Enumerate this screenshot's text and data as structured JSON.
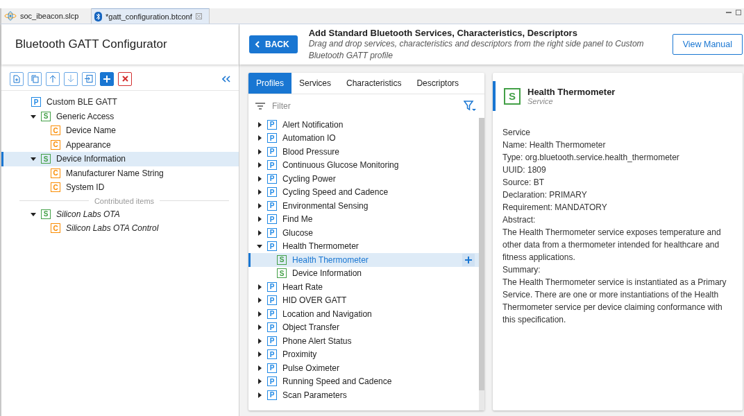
{
  "editor_tabs": [
    {
      "label": "soc_ibeacon.slcp",
      "kind": "project",
      "selected": false,
      "closable": false
    },
    {
      "label": "*gatt_configuration.btconf",
      "kind": "bluetooth",
      "selected": true,
      "closable": true
    }
  ],
  "configurator": {
    "title": "Bluetooth GATT Configurator",
    "tree": [
      {
        "label": "Custom BLE GATT",
        "kind": "profile",
        "badge": "P",
        "selected": false,
        "children": [
          {
            "label": "Generic Access",
            "kind": "service",
            "badge": "S",
            "expanded": true,
            "selected": false,
            "children": [
              {
                "label": "Device Name",
                "kind": "characteristic",
                "badge": "C",
                "selected": false
              },
              {
                "label": "Appearance",
                "kind": "characteristic",
                "badge": "C",
                "selected": false
              }
            ]
          },
          {
            "label": "Device Information",
            "kind": "service",
            "badge": "S",
            "expanded": true,
            "selected": true,
            "children": [
              {
                "label": "Manufacturer Name String",
                "kind": "characteristic",
                "badge": "C",
                "selected": false
              },
              {
                "label": "System ID",
                "kind": "characteristic",
                "badge": "C",
                "selected": false
              }
            ]
          }
        ]
      }
    ],
    "contributed_label": "Contributed items",
    "contributed": [
      {
        "label": "Silicon Labs OTA",
        "kind": "service",
        "badge": "S",
        "expanded": true,
        "selected": false,
        "children": [
          {
            "label": "Silicon Labs OTA Control",
            "kind": "characteristic",
            "badge": "C",
            "selected": false
          }
        ]
      }
    ]
  },
  "header": {
    "back_button": "BACK",
    "title": "Add Standard Bluetooth Services, Characteristics, Descriptors",
    "subtitle": "Drag and drop services, characteristics and descriptors from the right side panel to Custom Bluetooth GATT profile",
    "manual_button": "View Manual"
  },
  "library": {
    "tabs": [
      {
        "label": "Profiles",
        "selected": true
      },
      {
        "label": "Services",
        "selected": false
      },
      {
        "label": "Characteristics",
        "selected": false
      },
      {
        "label": "Descriptors",
        "selected": false
      }
    ],
    "filter": {
      "placeholder": "Filter"
    },
    "items": [
      {
        "label": "Alert Notification",
        "kind": "profile",
        "badge": "P",
        "expanded": false,
        "selected": false
      },
      {
        "label": "Automation IO",
        "kind": "profile",
        "badge": "P",
        "expanded": false,
        "selected": false
      },
      {
        "label": "Blood Pressure",
        "kind": "profile",
        "badge": "P",
        "expanded": false,
        "selected": false
      },
      {
        "label": "Continuous Glucose Monitoring",
        "kind": "profile",
        "badge": "P",
        "expanded": false,
        "selected": false
      },
      {
        "label": "Cycling Power",
        "kind": "profile",
        "badge": "P",
        "expanded": false,
        "selected": false
      },
      {
        "label": "Cycling Speed and Cadence",
        "kind": "profile",
        "badge": "P",
        "expanded": false,
        "selected": false
      },
      {
        "label": "Environmental Sensing",
        "kind": "profile",
        "badge": "P",
        "expanded": false,
        "selected": false
      },
      {
        "label": "Find Me",
        "kind": "profile",
        "badge": "P",
        "expanded": false,
        "selected": false
      },
      {
        "label": "Glucose",
        "kind": "profile",
        "badge": "P",
        "expanded": false,
        "selected": false
      },
      {
        "label": "Health Thermometer",
        "kind": "profile",
        "badge": "P",
        "expanded": true,
        "selected": false,
        "children": [
          {
            "label": "Health Thermometer",
            "kind": "service",
            "badge": "S",
            "selected": true
          },
          {
            "label": "Device Information",
            "kind": "service",
            "badge": "S",
            "selected": false
          }
        ]
      },
      {
        "label": "Heart Rate",
        "kind": "profile",
        "badge": "P",
        "expanded": false,
        "selected": false
      },
      {
        "label": "HID OVER GATT",
        "kind": "profile",
        "badge": "P",
        "expanded": false,
        "selected": false
      },
      {
        "label": "Location and Navigation",
        "kind": "profile",
        "badge": "P",
        "expanded": false,
        "selected": false
      },
      {
        "label": "Object Transfer",
        "kind": "profile",
        "badge": "P",
        "expanded": false,
        "selected": false
      },
      {
        "label": "Phone Alert Status",
        "kind": "profile",
        "badge": "P",
        "expanded": false,
        "selected": false
      },
      {
        "label": "Proximity",
        "kind": "profile",
        "badge": "P",
        "expanded": false,
        "selected": false
      },
      {
        "label": "Pulse Oximeter",
        "kind": "profile",
        "badge": "P",
        "expanded": false,
        "selected": false
      },
      {
        "label": "Running Speed and Cadence",
        "kind": "profile",
        "badge": "P",
        "expanded": false,
        "selected": false
      },
      {
        "label": "Scan Parameters",
        "kind": "profile",
        "badge": "P",
        "expanded": false,
        "selected": false
      }
    ]
  },
  "details": {
    "badge": "S",
    "kind": "service",
    "title": "Health Thermometer",
    "subtitle": "Service",
    "lines": [
      "Service",
      "Name: Health Thermometer",
      "Type: org.bluetooth.service.health_thermometer",
      "UUID: 1809",
      "Source: BT",
      "Declaration: PRIMARY",
      "Requirement: MANDATORY",
      "Abstract:",
      "The Health Thermometer service exposes temperature and other data from a thermometer intended for healthcare and fitness applications.",
      "Summary:",
      "The Health Thermometer service is instantiated as a Primary Service. There are one or more instantiations of the Health Thermometer service per device claiming conformance with this specification."
    ]
  }
}
